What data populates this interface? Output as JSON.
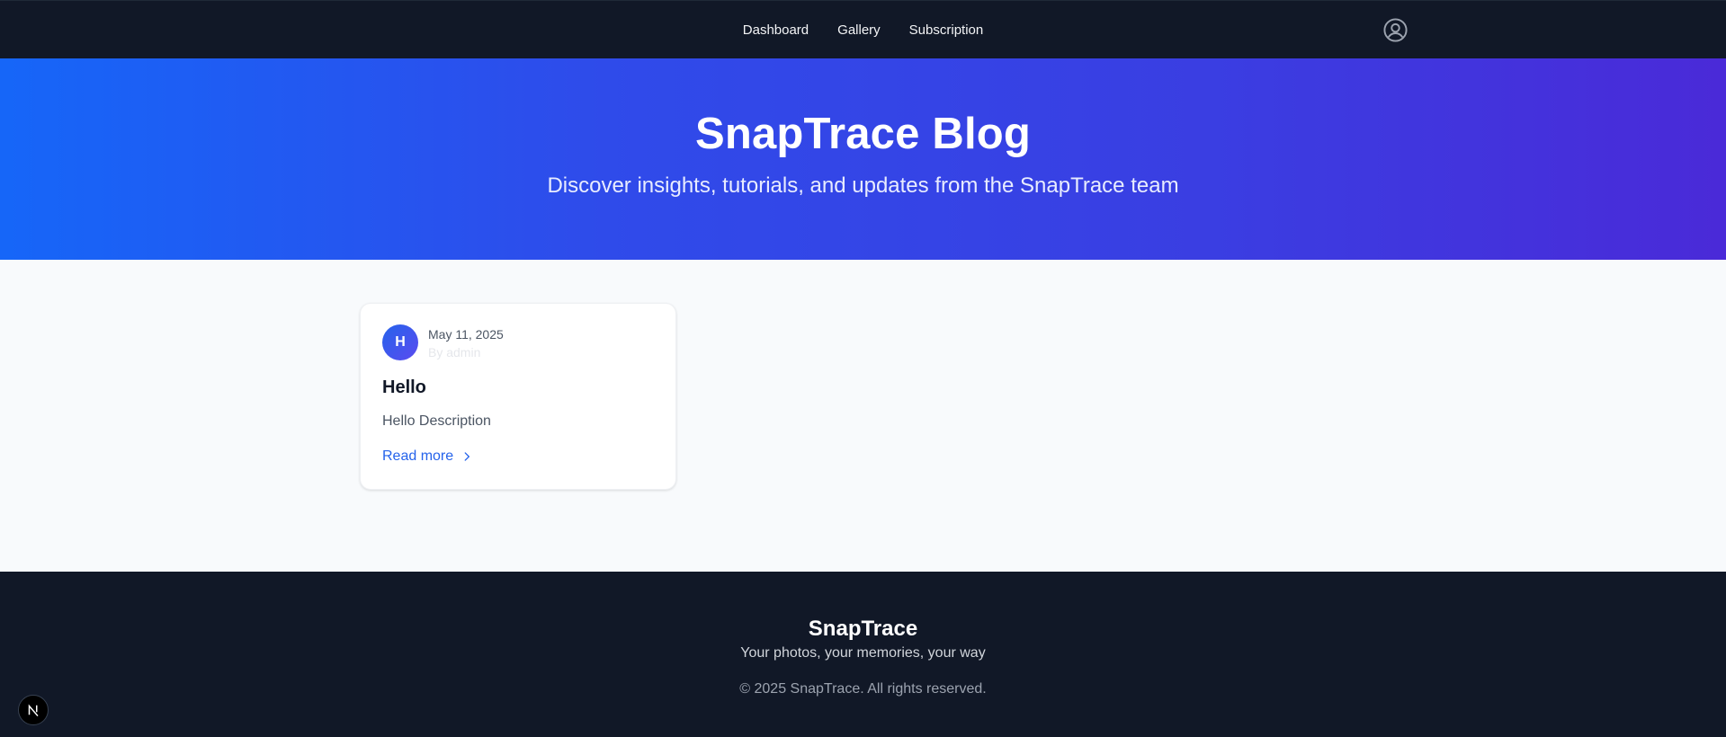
{
  "nav": {
    "links": [
      "Dashboard",
      "Gallery",
      "Subscription"
    ],
    "user_icon": "user-circle-icon"
  },
  "hero": {
    "title": "SnapTrace Blog",
    "subtitle": "Discover insights, tutorials, and updates from the SnapTrace team",
    "gradient_start": "#1666f8",
    "gradient_end": "#4a2ad8"
  },
  "posts": [
    {
      "avatar_letter": "H",
      "date": "May 11, 2025",
      "author": "By admin",
      "title": "Hello",
      "description": "Hello Description",
      "link_label": "Read more",
      "link_icon": "chevron-right-icon"
    }
  ],
  "footer": {
    "brand": "SnapTrace",
    "tagline": "Your photos, your memories, your way",
    "copyright": "© 2025 SnapTrace. All rights reserved."
  },
  "dev_badge": {
    "letter": "N",
    "icon": "nextjs-logo-icon"
  },
  "colors": {
    "nav_bg": "#111827",
    "accent": "#2563eb",
    "page_bg": "#f8fafc"
  }
}
